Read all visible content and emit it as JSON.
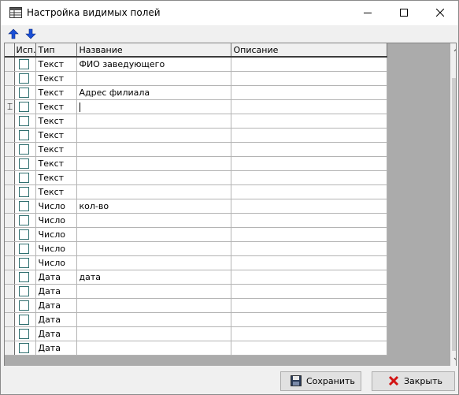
{
  "window": {
    "title": "Настройка видимых полей"
  },
  "columns": {
    "use": "Исп.",
    "type": "Тип",
    "name": "Название",
    "description": "Описание"
  },
  "rows": [
    {
      "type": "Текст",
      "name": "ФИО заведующего",
      "description": ""
    },
    {
      "type": "Текст",
      "name": "",
      "description": ""
    },
    {
      "type": "Текст",
      "name": "Адрес филиала",
      "description": ""
    },
    {
      "type": "Текст",
      "name": "",
      "description": "",
      "editing": true
    },
    {
      "type": "Текст",
      "name": "",
      "description": ""
    },
    {
      "type": "Текст",
      "name": "",
      "description": ""
    },
    {
      "type": "Текст",
      "name": "",
      "description": ""
    },
    {
      "type": "Текст",
      "name": "",
      "description": ""
    },
    {
      "type": "Текст",
      "name": "",
      "description": ""
    },
    {
      "type": "Текст",
      "name": "",
      "description": ""
    },
    {
      "type": "Число",
      "name": "кол-во",
      "description": ""
    },
    {
      "type": "Число",
      "name": "",
      "description": ""
    },
    {
      "type": "Число",
      "name": "",
      "description": ""
    },
    {
      "type": "Число",
      "name": "",
      "description": ""
    },
    {
      "type": "Число",
      "name": "",
      "description": ""
    },
    {
      "type": "Дата",
      "name": "дата",
      "description": ""
    },
    {
      "type": "Дата",
      "name": "",
      "description": ""
    },
    {
      "type": "Дата",
      "name": "",
      "description": ""
    },
    {
      "type": "Дата",
      "name": "",
      "description": ""
    },
    {
      "type": "Дата",
      "name": "",
      "description": ""
    },
    {
      "type": "Дата",
      "name": "",
      "description": ""
    }
  ],
  "footer": {
    "save_label": "Сохранить",
    "close_label": "Закрыть"
  },
  "icons": {
    "title": "table-grid-icon",
    "move_up": "arrow-up-icon",
    "move_down": "arrow-down-icon",
    "save": "floppy-disk-icon",
    "close": "red-cross-icon"
  },
  "colors": {
    "arrow_blue": "#1a4fd6",
    "close_red": "#d21414",
    "checkbox_border": "#2f6f6f"
  }
}
